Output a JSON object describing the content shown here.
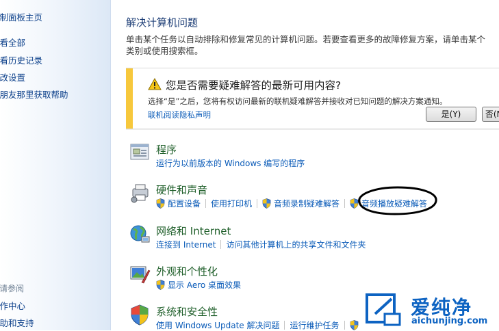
{
  "sidebar": {
    "items": [
      "控制面板主页",
      "查看全部",
      "查看历史记录",
      "更改设置",
      "从朋友那里获取帮助"
    ],
    "see_also": "另请参阅",
    "see_also_items": [
      "操作中心",
      "帮助和支持"
    ]
  },
  "main": {
    "title": "解决计算机问题",
    "description": "单击某个任务以自动排除和修复常见的计算机问题。若要查看更多的故障修复方案，请单击某个类别或使用搜索框。"
  },
  "banner": {
    "title": "您是否需要疑难解答的最新可用内容?",
    "text": "选择“是”之后，您将有权访问最新的联机疑难解答并接收对已知问题的解决方案通知。",
    "link": "联机阅读隐私声明",
    "yes_button": "是(Y)",
    "no_button": "否(N)",
    "accent_color": "#f7c83c"
  },
  "categories": [
    {
      "title": "程序",
      "icon": "programs-icon",
      "links": [
        "运行为以前版本的 Windows 编写的程序"
      ]
    },
    {
      "title": "硬件和声音",
      "icon": "hardware-sound-icon",
      "links": [
        "配置设备",
        "使用打印机",
        "音频录制疑难解答",
        "音频播放疑难解答"
      ]
    },
    {
      "title": "网络和 Internet",
      "icon": "network-icon",
      "links": [
        "连接到 Internet",
        "访问其他计算机上的共享文件和文件夹"
      ]
    },
    {
      "title": "外观和个性化",
      "icon": "appearance-icon",
      "links": [
        "显示 Aero 桌面效果"
      ]
    },
    {
      "title": "系统和安全性",
      "icon": "system-security-icon",
      "links": [
        "使用 Windows Update 解决问题",
        "运行维护任务"
      ]
    }
  ],
  "watermark": {
    "brand": "爱纯净",
    "url": "aichunjing.com"
  }
}
